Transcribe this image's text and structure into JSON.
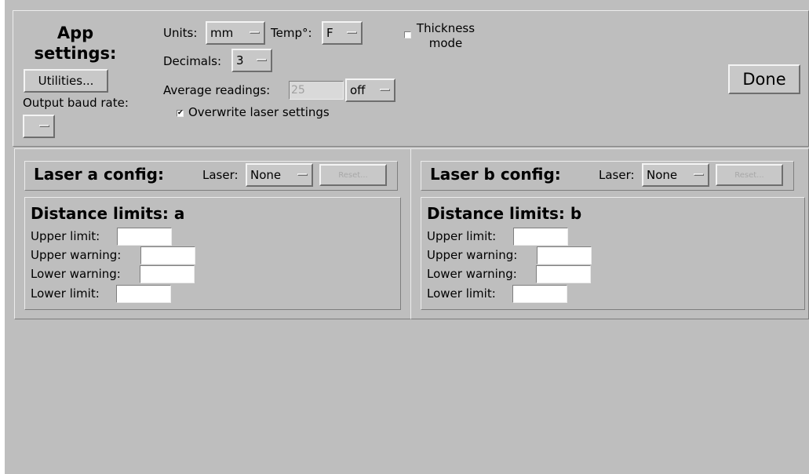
{
  "app_settings": {
    "title": "App\nsettings:",
    "utilities_button": "Utilities...",
    "output_baud_label": "Output baud rate:",
    "output_baud_value": "",
    "units_label": "Units:",
    "units_value": "mm",
    "temp_label": "Temp°:",
    "temp_value": "F",
    "decimals_label": "Decimals:",
    "decimals_value": "3",
    "average_label": "Average readings:",
    "average_value": "25",
    "average_mode": "off",
    "overwrite_label": "Overwrite laser settings",
    "overwrite_checked": true,
    "thickness_label": "Thickness\nmode",
    "thickness_checked": false,
    "done_button": "Done"
  },
  "lasers": [
    {
      "config_title": "Laser a config:",
      "laser_label": "Laser:",
      "laser_value": "None",
      "reset_button": "Reset...",
      "limits_title": "Distance limits: a",
      "upper_limit": "Upper limit:",
      "upper_warning": "Upper warning:",
      "lower_warning": "Lower warning:",
      "lower_limit": "Lower limit:"
    },
    {
      "config_title": "Laser b config:",
      "laser_label": "Laser:",
      "laser_value": "None",
      "reset_button": "Reset...",
      "limits_title": "Distance limits: b",
      "upper_limit": "Upper limit:",
      "upper_warning": "Upper warning:",
      "lower_warning": "Lower warning:",
      "lower_limit": "Lower limit:"
    }
  ]
}
